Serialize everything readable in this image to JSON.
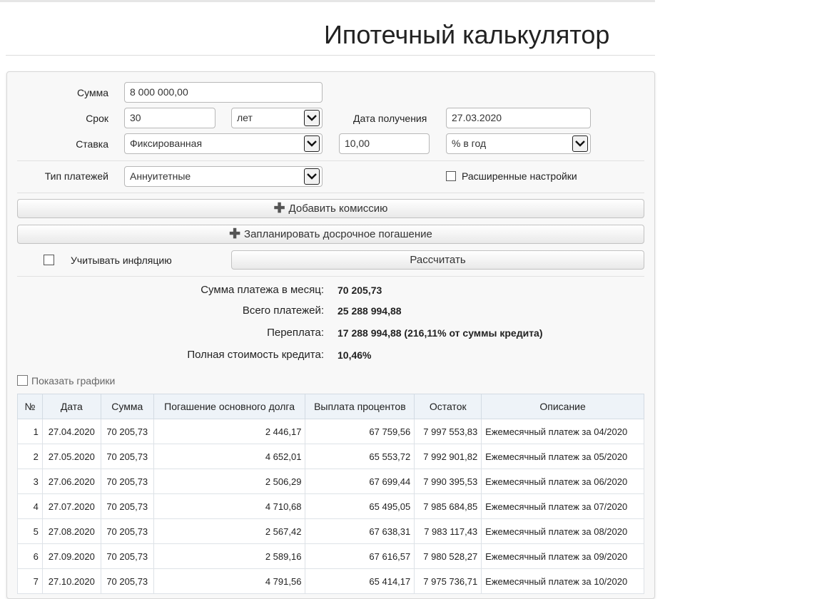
{
  "page": {
    "title": "Ипотечный калькулятор"
  },
  "form": {
    "sum_label": "Сумма",
    "sum_value": "8 000 000,00",
    "term_label": "Срок",
    "term_value": "30",
    "term_unit": "лет",
    "date_label": "Дата получения",
    "date_value": "27.03.2020",
    "rate_label": "Ставка",
    "rate_type": "Фиксированная",
    "rate_value": "10,00",
    "rate_unit": "% в год",
    "payment_type_label": "Тип платежей",
    "payment_type": "Аннуитетные",
    "advanced_label": "Расширенные настройки"
  },
  "actions": {
    "add_commission": "Добавить комиссию",
    "plan_prepayment": "Запланировать досрочное погашение",
    "inflation_label": "Учитывать инфляцию",
    "calculate": "Рассчитать"
  },
  "results": {
    "monthly_label": "Сумма платежа в месяц:",
    "monthly_value": "70 205,73",
    "total_label": "Всего платежей:",
    "total_value": "25 288 994,88",
    "overpay_label": "Переплата:",
    "overpay_value": "17 288 994,88 (216,11% от суммы кредита)",
    "psk_label": "Полная стоимость кредита:",
    "psk_value": "10,46%"
  },
  "charts_toggle": {
    "label": "Показать графики"
  },
  "schedule": {
    "headers": [
      "№",
      "Дата",
      "Сумма",
      "Погашение основного долга",
      "Выплата процентов",
      "Остаток",
      "Описание"
    ],
    "rows": [
      [
        "1",
        "27.04.2020",
        "70 205,73",
        "2 446,17",
        "67 759,56",
        "7 997 553,83",
        "Ежемесячный платеж за 04/2020"
      ],
      [
        "2",
        "27.05.2020",
        "70 205,73",
        "4 652,01",
        "65 553,72",
        "7 992 901,82",
        "Ежемесячный платеж за 05/2020"
      ],
      [
        "3",
        "27.06.2020",
        "70 205,73",
        "2 506,29",
        "67 699,44",
        "7 990 395,53",
        "Ежемесячный платеж за 06/2020"
      ],
      [
        "4",
        "27.07.2020",
        "70 205,73",
        "4 710,68",
        "65 495,05",
        "7 985 684,85",
        "Ежемесячный платеж за 07/2020"
      ],
      [
        "5",
        "27.08.2020",
        "70 205,73",
        "2 567,42",
        "67 638,31",
        "7 983 117,43",
        "Ежемесячный платеж за 08/2020"
      ],
      [
        "6",
        "27.09.2020",
        "70 205,73",
        "2 589,16",
        "67 616,57",
        "7 980 528,27",
        "Ежемесячный платеж за 09/2020"
      ],
      [
        "7",
        "27.10.2020",
        "70 205,73",
        "4 791,56",
        "65 414,17",
        "7 975 736,71",
        "Ежемесячный платеж за 10/2020"
      ]
    ]
  }
}
